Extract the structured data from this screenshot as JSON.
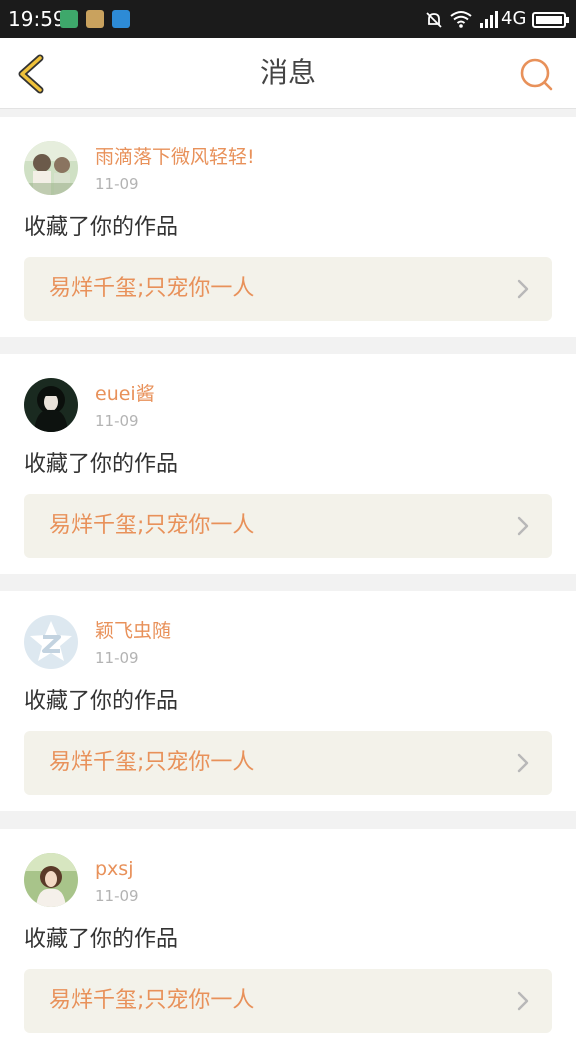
{
  "status_bar": {
    "time": "19:59",
    "network": "4G",
    "app_icons": [
      "shield-app-icon",
      "folder-app-icon",
      "scan-app-icon"
    ]
  },
  "header": {
    "title": "消息",
    "accent_color": "#e8a23a",
    "search_color": "#e8915a"
  },
  "messages": [
    {
      "username": "雨滴落下微风轻轻!",
      "date": "11-09",
      "action": "收藏了你的作品",
      "work_title": "易烊千玺;只宠你一人"
    },
    {
      "username": "euei酱",
      "date": "11-09",
      "action": "收藏了你的作品",
      "work_title": "易烊千玺;只宠你一人"
    },
    {
      "username": "颖飞虫随",
      "date": "11-09",
      "action": "收藏了你的作品",
      "work_title": "易烊千玺;只宠你一人"
    },
    {
      "username": "pxsj",
      "date": "11-09",
      "action": "收藏了你的作品",
      "work_title": "易烊千玺;只宠你一人"
    }
  ],
  "colors": {
    "username": "#e8915a",
    "date": "#b3b3b3",
    "work_bg": "#f3f2ea",
    "page_bg": "#f2f2f2"
  }
}
